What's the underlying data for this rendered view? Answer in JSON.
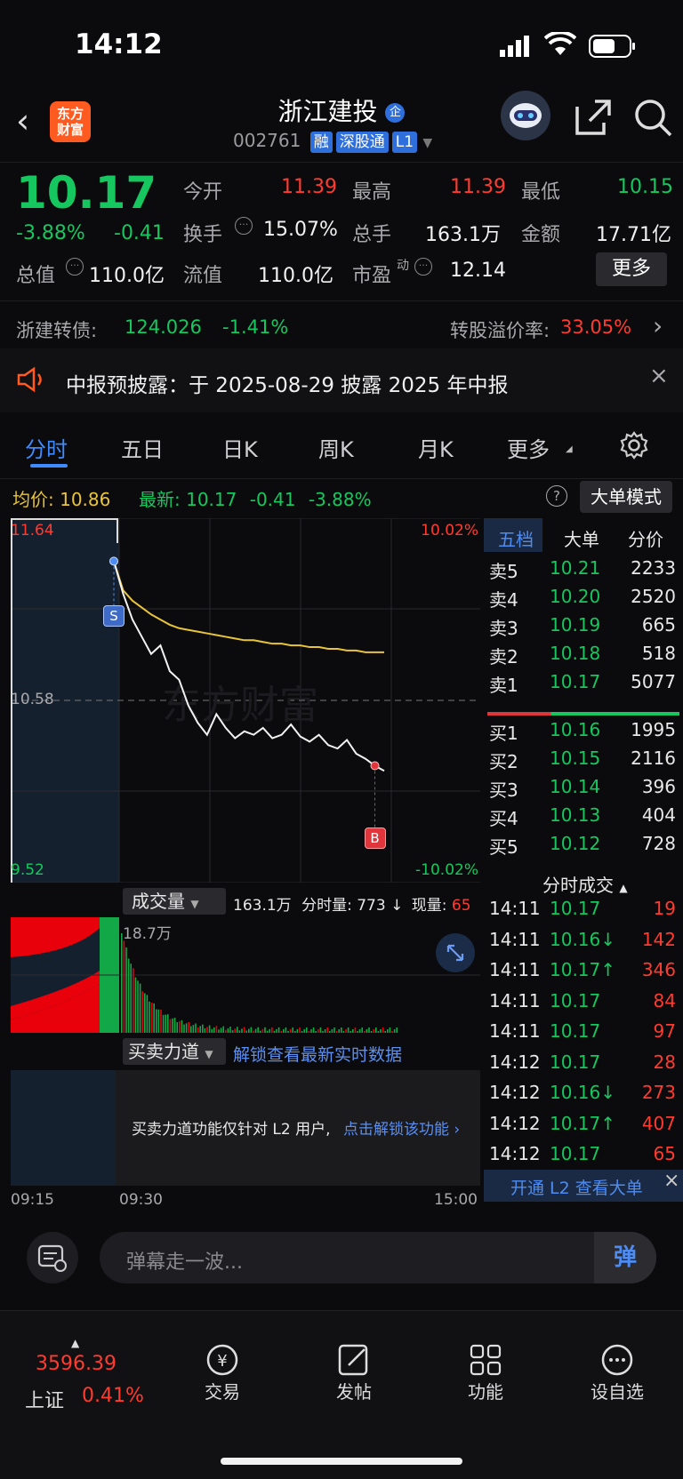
{
  "status": {
    "time": "14:12"
  },
  "header": {
    "logo_text": "东方\n财富",
    "stock_name": "浙江建投",
    "code": "002761",
    "tags": [
      "融",
      "深股通",
      "L1"
    ]
  },
  "quote": {
    "price": "10.17",
    "change_pct": "-3.88%",
    "change": "-0.41",
    "rows": [
      [
        {
          "label": "今开",
          "value": "11.39",
          "color": "red"
        },
        {
          "label": "最高",
          "value": "11.39",
          "color": "red"
        },
        {
          "label": "最低",
          "value": "10.15",
          "color": "green"
        }
      ],
      [
        {
          "label": "换手",
          "value": "15.07%",
          "color": "white"
        },
        {
          "label": "总手",
          "value": "163.1万",
          "color": "white"
        },
        {
          "label": "金额",
          "value": "17.71亿",
          "color": "white"
        }
      ],
      [
        {
          "label": "总值",
          "value": "110.0亿",
          "color": "white"
        },
        {
          "label": "流值",
          "value": "110.0亿",
          "color": "white"
        },
        {
          "label": "市盈",
          "value": "12.14",
          "color": "white"
        }
      ]
    ],
    "pe_sup": "动",
    "more_label": "更多"
  },
  "convertible": {
    "label": "浙建转债:",
    "price": "124.026",
    "pct": "-1.41%",
    "premium_label": "转股溢价率:",
    "premium": "33.05%"
  },
  "notice": {
    "text": "中报预披露：于 2025-08-29 披露 2025 年中报"
  },
  "tabs": [
    "分时",
    "五日",
    "日K",
    "周K",
    "月K",
    "更多"
  ],
  "active_tab": 0,
  "avg_line": {
    "avg_label": "均价:",
    "avg": "10.86",
    "latest_label": "最新:",
    "latest": "10.17",
    "chg": "-0.41",
    "pct": "-3.88%",
    "mode_label": "大单模式"
  },
  "chart_data": {
    "type": "line",
    "y_top_label": "11.64",
    "y_mid_label": "10.58",
    "y_bottom_label": "9.52",
    "pct_top": "10.02%",
    "pct_bottom": "-10.02%",
    "ylim": [
      9.52,
      11.64
    ],
    "prev_close": 10.58,
    "x_labels": [
      "09:15",
      "09:30",
      "15:00"
    ],
    "series": [
      {
        "values": [
          11.39,
          11.2,
          11.05,
          10.95,
          10.85,
          10.9,
          10.75,
          10.7,
          10.55,
          10.45,
          10.38,
          10.5,
          10.42,
          10.36,
          10.4,
          10.38,
          10.42,
          10.36,
          10.38,
          10.44,
          10.37,
          10.34,
          10.38,
          10.32,
          10.3,
          10.35,
          10.27,
          10.24,
          10.2,
          10.17
        ]
      },
      {
        "values": [
          11.39,
          11.22,
          11.16,
          11.12,
          11.08,
          11.05,
          11.02,
          11.0,
          10.99,
          10.98,
          10.97,
          10.96,
          10.95,
          10.94,
          10.93,
          10.93,
          10.92,
          10.91,
          10.91,
          10.9,
          10.9,
          10.89,
          10.89,
          10.88,
          10.88,
          10.87,
          10.87,
          10.86,
          10.86,
          10.86
        ]
      }
    ],
    "markers": [
      {
        "label": "S"
      },
      {
        "label": "B"
      }
    ]
  },
  "volume": {
    "selector": "成交量",
    "total": "163.1万",
    "period_label": "分时量:",
    "period": "773",
    "current_label": "现量:",
    "current": "65",
    "peak_label": "18.7万"
  },
  "force": {
    "selector": "买卖力道",
    "unlock_link": "解锁查看最新实时数据",
    "l2_text": "买卖力道功能仅针对 L2 用户,",
    "l2_link": "点击解锁该功能"
  },
  "orderbook": {
    "tabs": [
      "五档",
      "大单",
      "分价"
    ],
    "asks": [
      {
        "label": "卖5",
        "price": "10.21",
        "vol": "2233"
      },
      {
        "label": "卖4",
        "price": "10.20",
        "vol": "2520"
      },
      {
        "label": "卖3",
        "price": "10.19",
        "vol": "665"
      },
      {
        "label": "卖2",
        "price": "10.18",
        "vol": "518"
      },
      {
        "label": "卖1",
        "price": "10.17",
        "vol": "5077"
      }
    ],
    "bids": [
      {
        "label": "买1",
        "price": "10.16",
        "vol": "1995"
      },
      {
        "label": "买2",
        "price": "10.15",
        "vol": "2116"
      },
      {
        "label": "买3",
        "price": "10.14",
        "vol": "396"
      },
      {
        "label": "买4",
        "price": "10.13",
        "vol": "404"
      },
      {
        "label": "买5",
        "price": "10.12",
        "vol": "728"
      }
    ]
  },
  "trades": {
    "title": "分时成交",
    "rows": [
      {
        "t": "14:11",
        "p": "10.17",
        "v": "19",
        "arrow": ""
      },
      {
        "t": "14:11",
        "p": "10.16↓",
        "v": "142",
        "arrow": "down"
      },
      {
        "t": "14:11",
        "p": "10.17↑",
        "v": "346",
        "arrow": "up"
      },
      {
        "t": "14:11",
        "p": "10.17",
        "v": "84",
        "arrow": ""
      },
      {
        "t": "14:11",
        "p": "10.17",
        "v": "97",
        "arrow": ""
      },
      {
        "t": "14:12",
        "p": "10.17",
        "v": "28",
        "arrow": ""
      },
      {
        "t": "14:12",
        "p": "10.16↓",
        "v": "273",
        "arrow": "down"
      },
      {
        "t": "14:12",
        "p": "10.17↑",
        "v": "407",
        "arrow": "up"
      },
      {
        "t": "14:12",
        "p": "10.17",
        "v": "65",
        "arrow": ""
      }
    ],
    "l2_banner": "开通 L2 查看大单"
  },
  "comment": {
    "placeholder": "弹幕走一波...",
    "send_label": "弹"
  },
  "bottom_nav": {
    "index_value": "3596.39",
    "index_name": "上证",
    "index_pct": "0.41%",
    "items": [
      "交易",
      "发帖",
      "功能",
      "设自选"
    ]
  }
}
